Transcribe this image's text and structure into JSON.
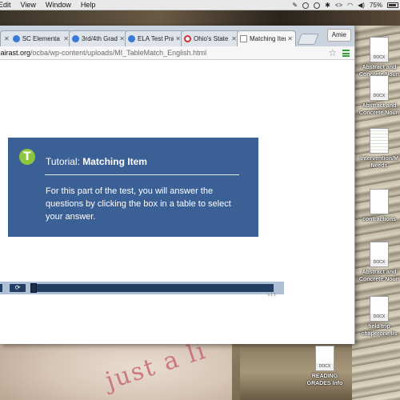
{
  "menubar": {
    "items": [
      "Edit",
      "View",
      "Window",
      "Help"
    ],
    "battery": "75%"
  },
  "browser": {
    "tabs": [
      {
        "label": "SC Elementa",
        "favicon_color": "#3a7bd5"
      },
      {
        "label": "3rd/4th Grad",
        "favicon_color": "#3a7bd5"
      },
      {
        "label": "ELA Test Pra",
        "favicon_color": "#3a7bd5"
      },
      {
        "label": "Ohio's State",
        "favicon_color": "#d03030"
      },
      {
        "label": "Matching Iten",
        "favicon_color": "#ffffff"
      }
    ],
    "profile": "Amie",
    "url_host": ".airast.org",
    "url_path": "/ocba/wp-content/uploads/MI_TableMatch_English.html"
  },
  "tutorial": {
    "badge": "T",
    "title_lead": "Tutorial:",
    "title_main": "Matching Item",
    "body": "For this part of the test, you will answer the questions by clicking the box in a table to select your answer.",
    "accent": "#3b6095",
    "badge_color": "#8cc63f"
  },
  "player": {
    "version": "v.1.1"
  },
  "desktop": {
    "icons": [
      {
        "badge": "DOCX",
        "label": "Abstract and Concrete Noun"
      },
      {
        "badge": "DOCX",
        "label": "Abstract and Concrete Noun"
      },
      {
        "badge": "",
        "label": "Intervention/M Needs"
      },
      {
        "badge": "",
        "label": "contractions"
      },
      {
        "badge": "DOCX",
        "label": "Abstract and Concrete Noun"
      },
      {
        "badge": "DOCX",
        "label": "field trip chaperone lis"
      },
      {
        "badge": "DOCX",
        "label": "READING GRADES  Info"
      }
    ],
    "shirt_text": "just a li"
  }
}
